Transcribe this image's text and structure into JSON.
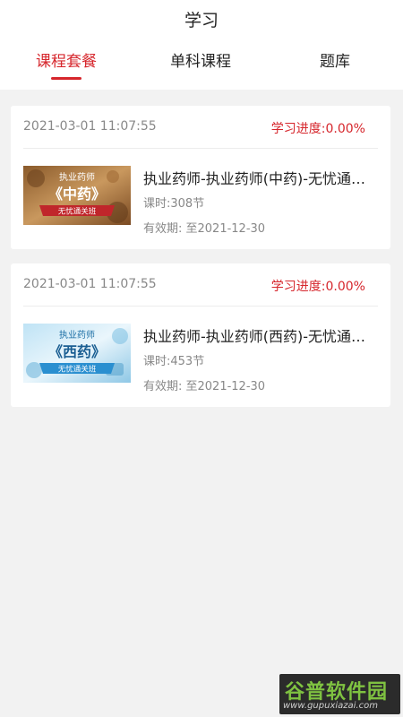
{
  "header": {
    "title": "学习",
    "tabs": [
      {
        "label": "课程套餐",
        "active": true
      },
      {
        "label": "单科课程",
        "active": false
      },
      {
        "label": "题库",
        "active": false
      }
    ]
  },
  "courses": [
    {
      "date": "2021-03-01 11:07:55",
      "progress": "学习进度:0.00%",
      "title": "执业药师-执业药师(中药)-无忧通关班",
      "hours": "课时:308节",
      "valid": "有效期: 至2021-12-30",
      "thumb": {
        "top_text": "执业药师",
        "main_text": "《中药》",
        "ribbon_text": "无忧通关班"
      }
    },
    {
      "date": "2021-03-01 11:07:55",
      "progress": "学习进度:0.00%",
      "title": "执业药师-执业药师(西药)-无忧通关班",
      "hours": "课时:453节",
      "valid": "有效期: 至2021-12-30",
      "thumb": {
        "top_text": "执业药师",
        "main_text": "《西药》",
        "ribbon_text": "无忧通关班"
      }
    }
  ],
  "watermark": {
    "logo": "谷普软件园",
    "url": "www.gupuxiazai.com"
  },
  "colors": {
    "accent": "#d6262c",
    "background": "#f2f2f2",
    "card": "#ffffff"
  }
}
